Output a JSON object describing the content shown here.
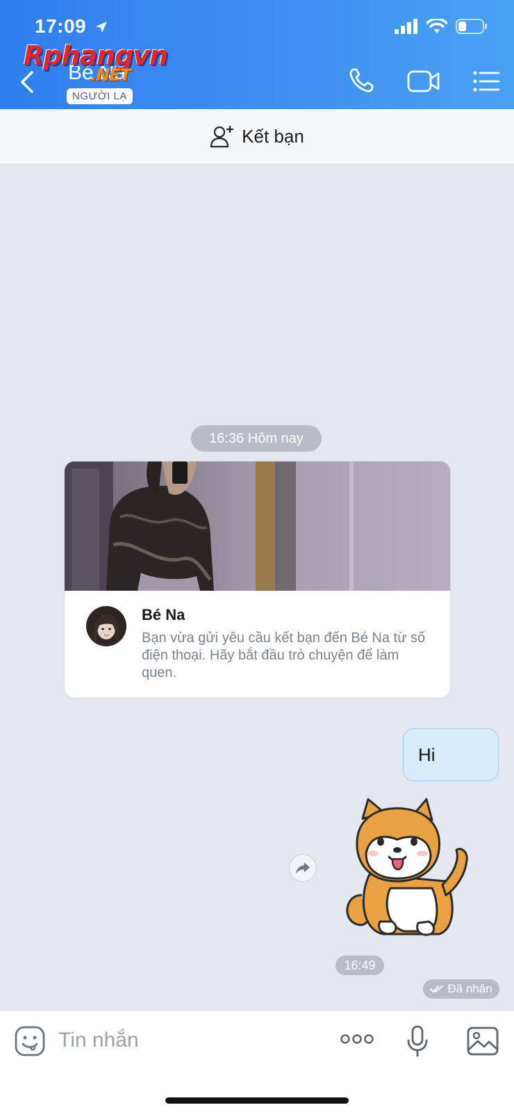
{
  "status_bar": {
    "time": "17:09"
  },
  "watermark": {
    "main": "Rphangvn",
    "suffix": ".NET"
  },
  "header": {
    "contact_name": "Bé Na",
    "badge": "NGƯỜI LẠ",
    "icons": [
      "back-chevron-icon",
      "phone-icon",
      "video-call-icon",
      "menu-list-icon"
    ]
  },
  "add_friend": {
    "label": "Kết bạn",
    "icon": "add-user-icon"
  },
  "chat": {
    "time_separator": "16:36 Hôm nay",
    "card": {
      "name": "Bé Na",
      "text": "Bạn vừa gửi yêu cầu kết bạn đến Bé Na từ số điện thoại. Hãy bắt đầu trò chuyện để làm quen."
    },
    "messages": [
      {
        "type": "text",
        "text": "Hi"
      },
      {
        "type": "sticker",
        "sticker": "shiba-dog-waving"
      }
    ],
    "last_time": "16:49",
    "delivery_status": "Đã nhận"
  },
  "composer": {
    "placeholder": "Tin nhắn",
    "icons": [
      "emoji-icon",
      "more-dots-icon",
      "microphone-icon",
      "image-icon"
    ]
  },
  "colors": {
    "header_gradient_start": "#2f7ef0",
    "header_gradient_end": "#4aa0f3",
    "chat_background": "#e3e7f0",
    "own_bubble": "#d9ecfc",
    "pill": "#b7bcc6"
  }
}
